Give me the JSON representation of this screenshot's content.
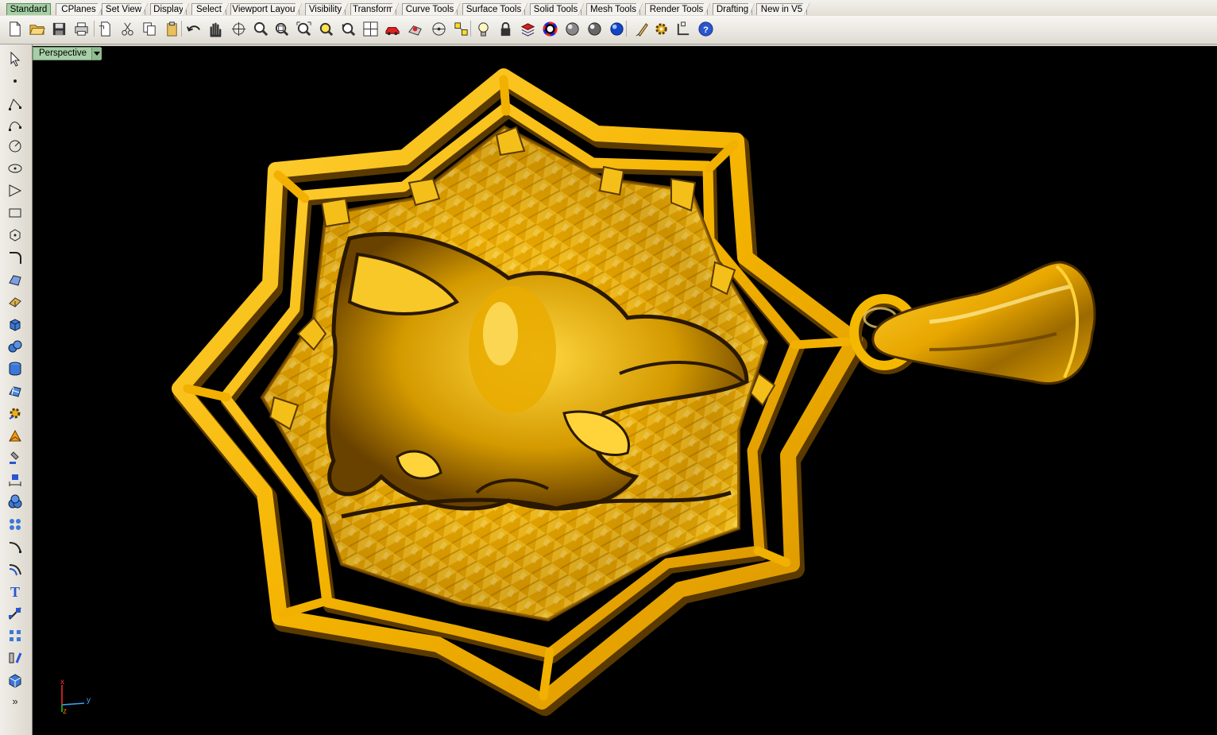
{
  "tabs": [
    {
      "label": "Standard",
      "active": true
    },
    {
      "label": "CPlanes"
    },
    {
      "label": "Set View"
    },
    {
      "label": "Display"
    },
    {
      "label": "Select"
    },
    {
      "label": "Viewport Layout"
    },
    {
      "label": "Visibility"
    },
    {
      "label": "Transform"
    },
    {
      "label": "Curve Tools"
    },
    {
      "label": "Surface Tools"
    },
    {
      "label": "Solid Tools"
    },
    {
      "label": "Mesh Tools"
    },
    {
      "label": "Render Tools"
    },
    {
      "label": "Drafting"
    },
    {
      "label": "New in V5"
    }
  ],
  "toolbar": [
    "new-file-icon",
    "open-folder-icon",
    "save-disk-icon",
    "print-icon",
    "import-icon",
    "cut-icon",
    "copy-icon",
    "paste-icon",
    "undo-icon",
    "pan-hand-icon",
    "rotate-view-icon",
    "zoom-dynamic-icon",
    "zoom-window-icon",
    "zoom-extents-icon",
    "zoom-selected-icon",
    "undo-view-icon",
    "four-viewports-icon",
    "car-options-icon",
    "named-views-icon",
    "cplane-icon",
    "object-snap-icon",
    "light-bulb-icon",
    "lock-icon",
    "layer-icon",
    "color-wheel-icon",
    "shaded-sphere-icon",
    "rendered-sphere-icon",
    "blue-sphere-icon",
    "properties-icon",
    "settings-gear-icon",
    "gumball-icon",
    "help-icon"
  ],
  "left_toolbar": [
    "select-arrow-icon",
    "point-icon",
    "polyline-icon",
    "curve-icon",
    "circle-icon",
    "ellipse-icon",
    "polygon-icon",
    "rectangle-icon",
    "hexagon-icon",
    "fillet-curve-icon",
    "surface-from-points-icon",
    "extrude-surface-icon",
    "box-solid-icon",
    "sphere-solid-icon",
    "cylinder-solid-icon",
    "mesh-icon",
    "gear-transform-icon",
    "orange-surface-icon",
    "move-icon",
    "dimension-icon",
    "boolean-union-icon",
    "group-icon",
    "fillet-edge-icon",
    "offset-curve-icon",
    "text-icon",
    "trim-icon",
    "array-icon",
    "mirror-icon",
    "block-icon",
    "more-icon"
  ],
  "viewport": {
    "name": "Perspective",
    "axes": {
      "x": "x",
      "y": "y",
      "z": "z"
    }
  },
  "colors": {
    "gold": "#f5b800",
    "gold_dark": "#7a4a00",
    "viewport_bg": "#000000",
    "tab_active": "#a4d0a4"
  }
}
